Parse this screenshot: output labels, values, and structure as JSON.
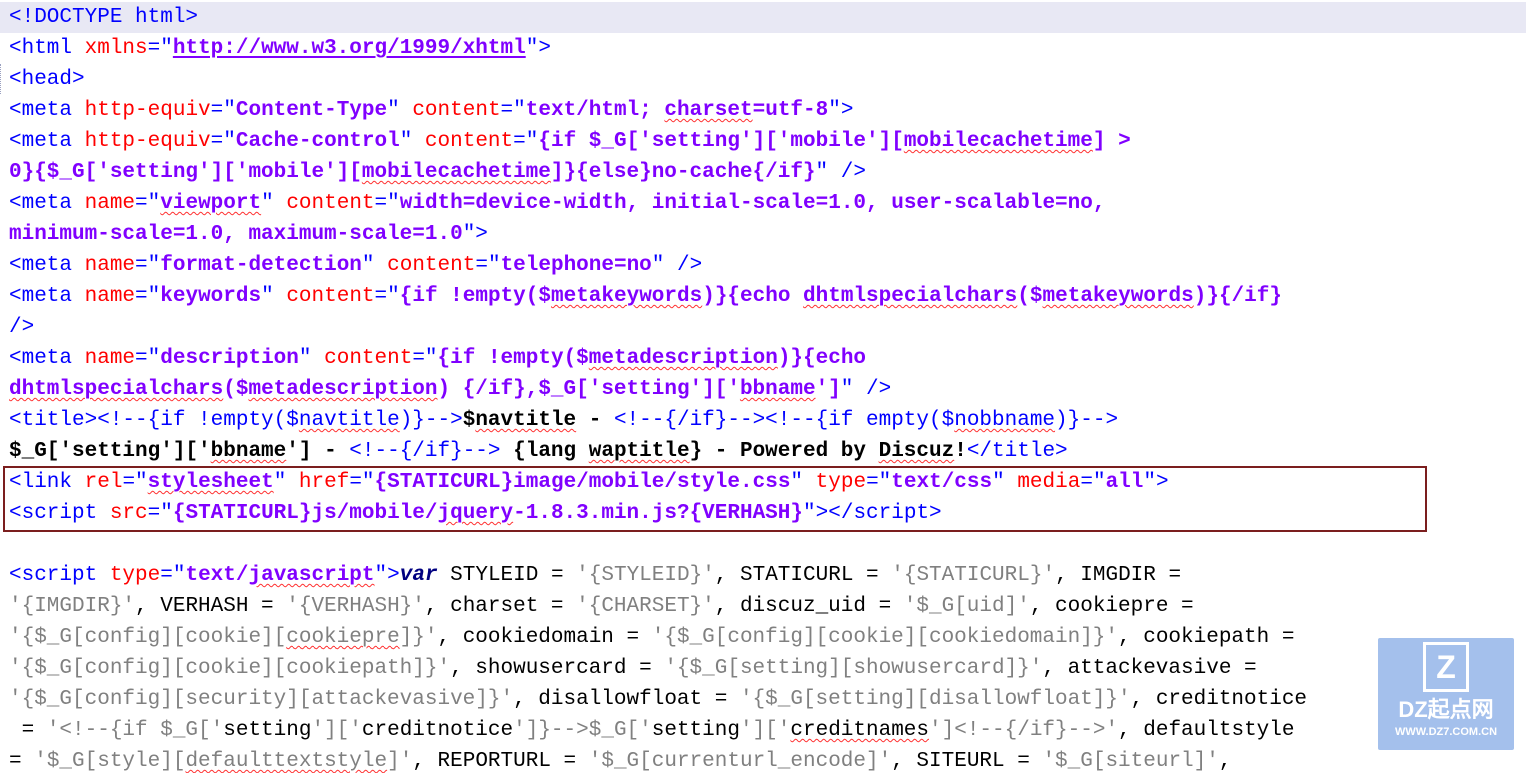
{
  "editor": {
    "lines": [
      {
        "hl": true,
        "segs": [
          [
            "t",
            "<!DOCTYPE html>"
          ]
        ]
      },
      {
        "hl": false,
        "segs": [
          [
            "t",
            "<html "
          ],
          [
            "a",
            "xmlns"
          ],
          [
            "t",
            "=\""
          ],
          [
            "v",
            "http://www.w3.org/1999/xhtml",
            "ul"
          ],
          [
            "t",
            "\">"
          ]
        ]
      },
      {
        "hl": false,
        "segs": [
          [
            "t",
            "<head>"
          ]
        ]
      },
      {
        "hl": false,
        "segs": [
          [
            "t",
            "<meta "
          ],
          [
            "a",
            "http-equiv"
          ],
          [
            "t",
            "=\""
          ],
          [
            "v",
            "Content-Type"
          ],
          [
            "t",
            "\" "
          ],
          [
            "a",
            "content"
          ],
          [
            "t",
            "=\""
          ],
          [
            "v",
            "text/html; "
          ],
          [
            "v",
            "charset",
            "sq"
          ],
          [
            "v",
            "=utf-8"
          ],
          [
            "t",
            "\">"
          ]
        ]
      },
      {
        "hl": false,
        "segs": [
          [
            "t",
            "<meta "
          ],
          [
            "a",
            "http-equiv"
          ],
          [
            "t",
            "=\""
          ],
          [
            "v",
            "Cache-control"
          ],
          [
            "t",
            "\" "
          ],
          [
            "a",
            "content"
          ],
          [
            "t",
            "=\""
          ],
          [
            "v",
            "{if $_G['setting']['mobile']["
          ],
          [
            "v",
            "mobilecachetime",
            "sq"
          ],
          [
            "v",
            "] >"
          ]
        ]
      },
      {
        "hl": false,
        "segs": [
          [
            "v",
            "0}{$_G['setting']['mobile']["
          ],
          [
            "v",
            "mobilecachetime",
            "sq"
          ],
          [
            "v",
            "]}{else}no-cache{/if}"
          ],
          [
            "t",
            "\" />"
          ]
        ]
      },
      {
        "hl": false,
        "segs": [
          [
            "t",
            "<meta "
          ],
          [
            "a",
            "name"
          ],
          [
            "t",
            "=\""
          ],
          [
            "v",
            "viewport",
            "sq"
          ],
          [
            "t",
            "\" "
          ],
          [
            "a",
            "content"
          ],
          [
            "t",
            "=\""
          ],
          [
            "v",
            "width=device-width, initial-scale=1.0, user-scalable=no,"
          ]
        ]
      },
      {
        "hl": false,
        "segs": [
          [
            "v",
            "minimum-scale=1.0, maximum-scale=1.0"
          ],
          [
            "t",
            "\">"
          ]
        ]
      },
      {
        "hl": false,
        "segs": [
          [
            "t",
            "<meta "
          ],
          [
            "a",
            "name"
          ],
          [
            "t",
            "=\""
          ],
          [
            "v",
            "format-detection"
          ],
          [
            "t",
            "\" "
          ],
          [
            "a",
            "content"
          ],
          [
            "t",
            "=\""
          ],
          [
            "v",
            "telephone=no"
          ],
          [
            "t",
            "\" />"
          ]
        ]
      },
      {
        "hl": false,
        "segs": [
          [
            "t",
            "<meta "
          ],
          [
            "a",
            "name"
          ],
          [
            "t",
            "=\""
          ],
          [
            "v",
            "keywords"
          ],
          [
            "t",
            "\" "
          ],
          [
            "a",
            "content"
          ],
          [
            "t",
            "=\""
          ],
          [
            "v",
            "{if !empty($"
          ],
          [
            "v",
            "metakeywords",
            "sq"
          ],
          [
            "v",
            ")}{echo "
          ],
          [
            "v",
            "dhtmlspecialchars",
            "sq"
          ],
          [
            "v",
            "($"
          ],
          [
            "v",
            "metakeywords",
            "sq"
          ],
          [
            "v",
            ")}{/if}"
          ]
        ]
      },
      {
        "hl": false,
        "segs": [
          [
            "t",
            "/>"
          ]
        ]
      },
      {
        "hl": false,
        "segs": [
          [
            "t",
            "<meta "
          ],
          [
            "a",
            "name"
          ],
          [
            "t",
            "=\""
          ],
          [
            "v",
            "description"
          ],
          [
            "t",
            "\" "
          ],
          [
            "a",
            "content"
          ],
          [
            "t",
            "=\""
          ],
          [
            "v",
            "{if !empty($"
          ],
          [
            "v",
            "metadescription",
            "sq"
          ],
          [
            "v",
            ")}{echo"
          ]
        ]
      },
      {
        "hl": false,
        "segs": [
          [
            "v",
            "dhtmlspecialchars",
            "sq"
          ],
          [
            "v",
            "($"
          ],
          [
            "v",
            "metadescription",
            "sq"
          ],
          [
            "v",
            ") {/if},$_G['setting']['"
          ],
          [
            "v",
            "bbname",
            "sq"
          ],
          [
            "v",
            "']"
          ],
          [
            "t",
            "\" />"
          ]
        ]
      },
      {
        "hl": false,
        "segs": [
          [
            "t",
            "<title>"
          ],
          [
            "t",
            "<!--{if !empty($"
          ],
          [
            "t",
            "navtitle",
            "sq"
          ],
          [
            "t",
            ")}-->"
          ],
          [
            "b",
            "$"
          ],
          [
            "b",
            "navtitle",
            "sq"
          ],
          [
            "b",
            " - "
          ],
          [
            "t",
            "<!--{/if}--><!--{if empty($"
          ],
          [
            "t",
            "nobbname",
            "sq"
          ],
          [
            "t",
            ")}-->"
          ]
        ]
      },
      {
        "hl": false,
        "segs": [
          [
            "b",
            "$_G['setting']['"
          ],
          [
            "b",
            "bbname",
            "sq"
          ],
          [
            "b",
            "'] - "
          ],
          [
            "t",
            "<!--{/if}-->"
          ],
          [
            "b",
            " {lang "
          ],
          [
            "b",
            "waptitle",
            "sq"
          ],
          [
            "b",
            "} - Powered by "
          ],
          [
            "b",
            "Discuz",
            "sq"
          ],
          [
            "b",
            "!"
          ],
          [
            "t",
            "</title>"
          ]
        ]
      },
      {
        "hl": false,
        "segs": [
          [
            "t",
            "<link "
          ],
          [
            "a",
            "rel"
          ],
          [
            "t",
            "=\""
          ],
          [
            "v",
            "stylesheet",
            "sq"
          ],
          [
            "t",
            "\" "
          ],
          [
            "a",
            "href"
          ],
          [
            "t",
            "=\""
          ],
          [
            "v",
            "{STATICURL}image/mobile/style.css"
          ],
          [
            "t",
            "\" "
          ],
          [
            "a",
            "type"
          ],
          [
            "t",
            "=\""
          ],
          [
            "v",
            "text/css"
          ],
          [
            "t",
            "\" "
          ],
          [
            "a",
            "media"
          ],
          [
            "t",
            "=\""
          ],
          [
            "v",
            "all"
          ],
          [
            "t",
            "\">"
          ]
        ]
      },
      {
        "hl": false,
        "segs": [
          [
            "t",
            "<script "
          ],
          [
            "a",
            "src"
          ],
          [
            "t",
            "=\""
          ],
          [
            "v",
            "{STATICURL}js/mobile/"
          ],
          [
            "v",
            "jquery",
            "sq"
          ],
          [
            "v",
            "-1.8.3.min.js?{VERHASH}"
          ],
          [
            "t",
            "\">"
          ],
          [
            "t",
            "</"
          ],
          [
            "t",
            "script>"
          ]
        ]
      },
      {
        "hl": false,
        "segs": [
          [
            "n",
            " "
          ]
        ]
      },
      {
        "hl": false,
        "segs": [
          [
            "t",
            "<script "
          ],
          [
            "a",
            "type"
          ],
          [
            "t",
            "=\""
          ],
          [
            "v",
            "text/"
          ],
          [
            "v",
            "javascript",
            "sq"
          ],
          [
            "t",
            "\">"
          ],
          [
            "k",
            "var"
          ],
          [
            "n",
            " STYLEID = "
          ],
          [
            "s",
            "'{STYLEID}'"
          ],
          [
            "n",
            ", STATICURL = "
          ],
          [
            "s",
            "'{STATICURL}'"
          ],
          [
            "n",
            ", IMGDIR = "
          ]
        ]
      },
      {
        "hl": false,
        "segs": [
          [
            "s",
            "'{IMGDIR}'"
          ],
          [
            "n",
            ", VERHASH = "
          ],
          [
            "s",
            "'{VERHASH}'"
          ],
          [
            "n",
            ", charset = "
          ],
          [
            "s",
            "'{CHARSET}'"
          ],
          [
            "n",
            ", discuz_uid = "
          ],
          [
            "s",
            "'$_G[uid]'"
          ],
          [
            "n",
            ", cookiepre = "
          ]
        ]
      },
      {
        "hl": false,
        "segs": [
          [
            "s",
            "'{$_G[config][cookie]["
          ],
          [
            "s",
            "cookiepre",
            "sq"
          ],
          [
            "s",
            "]}'"
          ],
          [
            "n",
            ", cookiedomain = "
          ],
          [
            "s",
            "'{$_G[config][cookie][cookiedomain]}'"
          ],
          [
            "n",
            ", cookiepath ="
          ]
        ]
      },
      {
        "hl": false,
        "segs": [
          [
            "s",
            "'{$_G[config][cookie][cookiepath]}'"
          ],
          [
            "n",
            ", showusercard = "
          ],
          [
            "s",
            "'{$_G[setting][showusercard]}'"
          ],
          [
            "n",
            ", attackevasive ="
          ]
        ]
      },
      {
        "hl": false,
        "segs": [
          [
            "s",
            "'{$_G[config][security][attackevasive]}'"
          ],
          [
            "n",
            ", disallowfloat = "
          ],
          [
            "s",
            "'{$_G[setting][disallowfloat]}'"
          ],
          [
            "n",
            ", creditnotice"
          ]
        ]
      },
      {
        "hl": false,
        "segs": [
          [
            "n",
            " = "
          ],
          [
            "s",
            "'<!--{if $_G['"
          ],
          [
            "n",
            "setting"
          ],
          [
            "s",
            "']['"
          ],
          [
            "n",
            "creditnotice"
          ],
          [
            "s",
            "']}-->$_G['"
          ],
          [
            "n",
            "setting"
          ],
          [
            "s",
            "']['"
          ],
          [
            "n",
            "creditnames",
            "sq"
          ],
          [
            "s",
            "']<!--{/if}-->'"
          ],
          [
            "n",
            ", defaultstyle"
          ]
        ]
      },
      {
        "hl": false,
        "segs": [
          [
            "n",
            "= "
          ],
          [
            "s",
            "'$_G[style]["
          ],
          [
            "s",
            "defaulttextstyle",
            "sq"
          ],
          [
            "s",
            "]'"
          ],
          [
            "n",
            ", REPORTURL = "
          ],
          [
            "s",
            "'$_G[currenturl_encode]'"
          ],
          [
            "n",
            ", SITEURL = "
          ],
          [
            "s",
            "'$_G[siteurl]'"
          ],
          [
            "n",
            ","
          ]
        ]
      }
    ]
  },
  "watermark": {
    "logo_letter": "Z",
    "brand": "DZ起点网",
    "site": "WWW.DZ7.COM.CN"
  }
}
